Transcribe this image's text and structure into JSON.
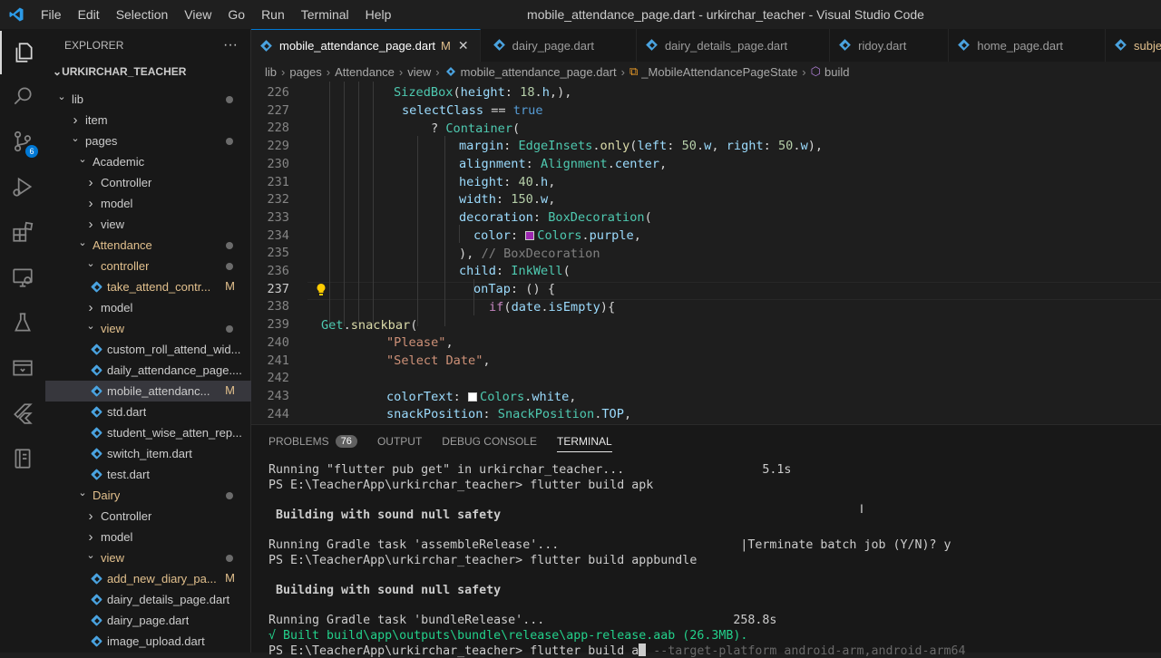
{
  "titlebar": {
    "menu": [
      "File",
      "Edit",
      "Selection",
      "View",
      "Go",
      "Run",
      "Terminal",
      "Help"
    ],
    "window_title": "mobile_attendance_page.dart - urkirchar_teacher - Visual Studio Code"
  },
  "activity_bar": {
    "items": [
      "explorer-icon",
      "search-icon",
      "source-control-icon",
      "run-debug-icon",
      "extensions-icon",
      "remote-explorer-icon",
      "testing-icon",
      "remote-icon",
      "flutter-icon",
      "notebook-icon"
    ],
    "source_control_badge": "6"
  },
  "sidebar": {
    "title": "EXPLORER",
    "more": "···",
    "root": "URKIRCHAR_TEACHER",
    "items": [
      {
        "label": "lib",
        "depth": 1,
        "type": "folder-open",
        "dot": true
      },
      {
        "label": "item",
        "depth": 2,
        "type": "folder"
      },
      {
        "label": "pages",
        "depth": 2,
        "type": "folder-open",
        "dot": true
      },
      {
        "label": "Academic",
        "depth": 3,
        "type": "folder-open"
      },
      {
        "label": "Controller",
        "depth": 4,
        "type": "folder"
      },
      {
        "label": "model",
        "depth": 4,
        "type": "folder"
      },
      {
        "label": "view",
        "depth": 4,
        "type": "folder"
      },
      {
        "label": "Attendance",
        "depth": 3,
        "type": "folder-open",
        "dot": true,
        "modified": true
      },
      {
        "label": "controller",
        "depth": 4,
        "type": "folder-open",
        "dot": true,
        "modified": true
      },
      {
        "label": "take_attend_contr...",
        "depth": 5,
        "type": "file",
        "status": "M",
        "modified": true
      },
      {
        "label": "model",
        "depth": 4,
        "type": "folder"
      },
      {
        "label": "view",
        "depth": 4,
        "type": "folder-open",
        "dot": true,
        "modified": true
      },
      {
        "label": "custom_roll_attend_wid...",
        "depth": 5,
        "type": "file"
      },
      {
        "label": "daily_attendance_page....",
        "depth": 5,
        "type": "file"
      },
      {
        "label": "mobile_attendanc...",
        "depth": 5,
        "type": "file",
        "status": "M",
        "selected": true
      },
      {
        "label": "std.dart",
        "depth": 5,
        "type": "file"
      },
      {
        "label": "student_wise_atten_rep...",
        "depth": 5,
        "type": "file"
      },
      {
        "label": "switch_item.dart",
        "depth": 5,
        "type": "file"
      },
      {
        "label": "test.dart",
        "depth": 5,
        "type": "file"
      },
      {
        "label": "Dairy",
        "depth": 3,
        "type": "folder-open",
        "dot": true,
        "modified": true
      },
      {
        "label": "Controller",
        "depth": 4,
        "type": "folder"
      },
      {
        "label": "model",
        "depth": 4,
        "type": "folder"
      },
      {
        "label": "view",
        "depth": 4,
        "type": "folder-open",
        "dot": true,
        "modified": true
      },
      {
        "label": "add_new_diary_pa...",
        "depth": 5,
        "type": "file",
        "status": "M",
        "modified": true
      },
      {
        "label": "dairy_details_page.dart",
        "depth": 5,
        "type": "file"
      },
      {
        "label": "dairy_page.dart",
        "depth": 5,
        "type": "file"
      },
      {
        "label": "image_upload.dart",
        "depth": 5,
        "type": "file"
      }
    ]
  },
  "tabs": [
    {
      "label": "mobile_attendance_page.dart",
      "status": "M",
      "active": true,
      "close": "✕"
    },
    {
      "label": "dairy_page.dart"
    },
    {
      "label": "dairy_details_page.dart"
    },
    {
      "label": "ridoy.dart"
    },
    {
      "label": "home_page.dart"
    },
    {
      "label": "subject_mod"
    }
  ],
  "breadcrumb": [
    "lib",
    "pages",
    "Attendance",
    "view",
    "mobile_attendance_page.dart",
    "_MobileAttendancePageState",
    "build"
  ],
  "editor": {
    "current_line": "237",
    "line_numbers": [
      "226",
      "227",
      "228",
      "229",
      "230",
      "231",
      "232",
      "233",
      "234",
      "235",
      "236",
      "237",
      "238",
      "239",
      "240",
      "241",
      "242",
      "243",
      "244"
    ],
    "code": {
      "l226": [
        "SizedBox",
        "(",
        "height",
        ": ",
        "18",
        ".",
        "h",
        ",),"
      ],
      "l227": [
        "selectClass",
        " == ",
        "true"
      ],
      "l228": [
        "? ",
        "Container",
        "("
      ],
      "l229": [
        "margin",
        ": ",
        "EdgeInsets",
        ".",
        "only",
        "(",
        "left",
        ": ",
        "50",
        ".",
        "w",
        ", ",
        "right",
        ": ",
        "50",
        ".",
        "w",
        "),"
      ],
      "l230": [
        "alignment",
        ": ",
        "Alignment",
        ".",
        "center",
        ","
      ],
      "l231": [
        "height",
        ": ",
        "40",
        ".",
        "h",
        ","
      ],
      "l232": [
        "width",
        ": ",
        "150",
        ".",
        "w",
        ","
      ],
      "l233": [
        "decoration",
        ": ",
        "BoxDecoration",
        "("
      ],
      "l234": [
        "color",
        ": ",
        "Colors",
        ".",
        "purple",
        ","
      ],
      "l235": [
        "), ",
        "// BoxDecoration"
      ],
      "l236": [
        "child",
        ": ",
        "InkWell",
        "("
      ],
      "l237": [
        "onTap",
        ": () {"
      ],
      "l238": [
        "if",
        "(",
        "date",
        ".",
        "isEmpty",
        "){"
      ],
      "l239": [
        "Get",
        ".",
        "snackbar",
        "("
      ],
      "l240": [
        "\"Please\"",
        ","
      ],
      "l241": [
        "\"Select Date\"",
        ","
      ],
      "l242": [
        ""
      ],
      "l243": [
        "colorText",
        ": ",
        "Colors",
        ".",
        "white",
        ","
      ],
      "l244": [
        "snackPosition",
        ": ",
        "SnackPosition",
        ".",
        "TOP",
        ","
      ]
    },
    "swatch_purple": "#9c27b0",
    "swatch_white": "#ffffff"
  },
  "panel": {
    "tabs": [
      "PROBLEMS",
      "OUTPUT",
      "DEBUG CONSOLE",
      "TERMINAL"
    ],
    "problems_count": "76",
    "active_tab": "TERMINAL"
  },
  "terminal": {
    "lines": [
      "Running \"flutter pub get\" in urkirchar_teacher...                   5.1s",
      "PS E:\\TeacherApp\\urkirchar_teacher> flutter build apk",
      "",
      " Building with sound null safety",
      "",
      "Running Gradle task 'assembleRelease'...                         |Terminate batch job (Y/N)? y",
      "PS E:\\TeacherApp\\urkirchar_teacher> flutter build appbundle",
      "",
      " Building with sound null safety",
      "",
      "Running Gradle task 'bundleRelease'...                          258.8s",
      "√ Built build\\app\\outputs\\bundle\\release\\app-release.aab (26.3MB).",
      "PS E:\\TeacherApp\\urkirchar_teacher> flutter build a"
    ],
    "ghost_text": "--target-platform android-arm,android-arm64"
  },
  "colors": {
    "accent": "#0078d4",
    "modified": "#e2c08d",
    "success": "#23d18b"
  }
}
